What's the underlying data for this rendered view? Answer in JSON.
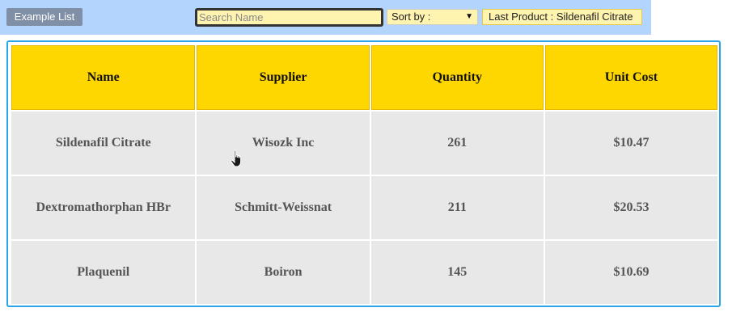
{
  "toolbar": {
    "example_list_label": "Example List",
    "search_placeholder": "Search Name",
    "search_value": "",
    "sort_label": "Sort by :",
    "last_product_label": "Last Product : Sildenafil Citrate"
  },
  "table": {
    "headers": [
      "Name",
      "Supplier",
      "Quantity",
      "Unit Cost"
    ],
    "rows": [
      [
        "Sildenafil Citrate",
        "Wisozk Inc",
        "261",
        "$10.47"
      ],
      [
        "Dextromathorphan HBr",
        "Schmitt-Weissnat",
        "211",
        "$20.53"
      ],
      [
        "Plaquenil",
        "Boiron",
        "145",
        "$10.69"
      ]
    ]
  },
  "colors": {
    "toolbar_bg": "#b3d4fc",
    "header_bg": "#ffd700",
    "cell_bg": "#e8e8e8",
    "frame_border": "#29a6e8"
  },
  "icons": {
    "cursor": "hand-pointer-icon"
  }
}
